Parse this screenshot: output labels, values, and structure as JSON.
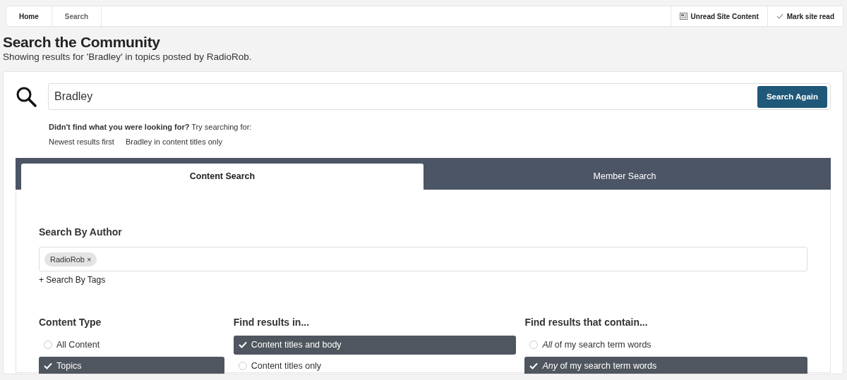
{
  "breadcrumb": [
    {
      "label": "Home",
      "current": false
    },
    {
      "label": "Search",
      "current": true
    }
  ],
  "header_actions": [
    {
      "kind": "unread",
      "label": "Unread Site Content"
    },
    {
      "kind": "mark",
      "label": "Mark site read"
    }
  ],
  "page": {
    "title": "Search the Community",
    "subtitle": "Showing results for 'Bradley' in topics posted by RadioRob."
  },
  "search": {
    "value": "Bradley",
    "button": "Search Again"
  },
  "hint": {
    "text": "**Didn't find what you were looking for?** Try searching for:",
    "links": [
      "Newest results first",
      "Bradley in content titles only"
    ]
  },
  "tabs": [
    {
      "label": "Content Search",
      "selected": true
    },
    {
      "label": "Member Search",
      "selected": false
    }
  ],
  "author": {
    "label": "Search By Author",
    "tags": [
      {
        "label": "RadioRob",
        "remove": "×"
      }
    ]
  },
  "tags_toggle": {
    "icon": "+",
    "label": "Search By Tags"
  },
  "option_groups": [
    {
      "title": "Content Type",
      "options": [
        {
          "label": "All Content",
          "selected": false
        },
        {
          "label": "Topics",
          "selected": true
        }
      ]
    },
    {
      "title": "Find results in...",
      "options": [
        {
          "label": "Content titles and body",
          "selected": true
        },
        {
          "label": "Content titles only",
          "selected": false
        }
      ]
    },
    {
      "title": "Find results that contain...",
      "options": [
        {
          "label": "*All* of my search term words",
          "selected": false
        },
        {
          "label": "*Any* of my search term words",
          "selected": true
        }
      ]
    }
  ]
}
